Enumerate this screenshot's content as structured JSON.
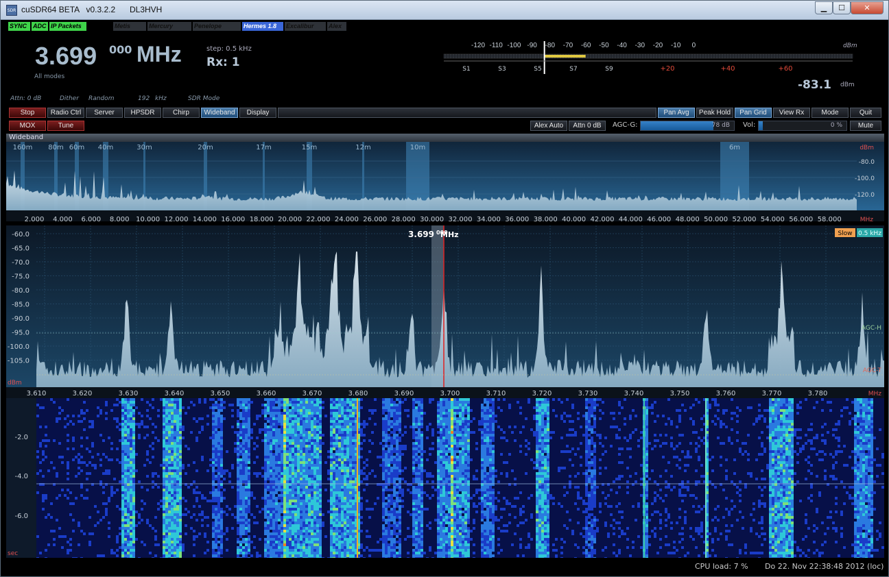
{
  "window": {
    "title": "cuSDR64 BETA   v0.3.2.2",
    "callsign": "DL3HVH",
    "min_label": "▁",
    "max_label": "☐",
    "close_label": "✕"
  },
  "status_indicators": [
    {
      "label": "SYNC",
      "active": true
    },
    {
      "label": "ADC",
      "active": true
    },
    {
      "label": "IP Packets",
      "active": true
    },
    {
      "label": "Metis",
      "active": false
    },
    {
      "label": "Mercury",
      "active": false
    },
    {
      "label": "Penelope",
      "active": false
    },
    {
      "label": "Hermes 1.8",
      "active": true
    },
    {
      "label": "Excalibur",
      "active": false
    },
    {
      "label": "Alex",
      "active": false
    }
  ],
  "display": {
    "frequency_main": "3.699",
    "frequency_sub": "000",
    "frequency_unit": "MHz",
    "step": "step: 0.5 kHz",
    "rx": "Rx: 1",
    "mode": "All modes",
    "attn": "Attn: 0 dB",
    "dither": "Dither",
    "random": "Random",
    "samplerate": "192",
    "samplerate_unit": "kHz",
    "sdr_mode": "SDR Mode",
    "dbm_value": "-83.1",
    "dbm_unit": "dBm"
  },
  "smeter": {
    "dbm_scale": [
      "-120",
      "-110",
      "-100",
      "-90",
      "-80",
      "-70",
      "-60",
      "-50",
      "-40",
      "-30",
      "-20",
      "-10",
      "0"
    ],
    "dbm_label": "dBm",
    "s_scale": [
      "S1",
      "S3",
      "S5",
      "S7",
      "S9"
    ],
    "plus_scale": [
      "+20",
      "+40",
      "+60"
    ],
    "level_dbm": -83.1
  },
  "controls_row1": {
    "stop": "Stop",
    "radio_ctrl": "Radio Ctrl",
    "server": "Server",
    "hpsdr": "HPSDR",
    "chirp": "Chirp",
    "wideband": "Wideband",
    "display": "Display",
    "pan_avg": "Pan Avg",
    "peak_hold": "Peak Hold",
    "pan_grid": "Pan Grid",
    "view_rx": "View Rx",
    "mode": "Mode",
    "quit": "Quit"
  },
  "controls_row2": {
    "mox": "MOX",
    "tune": "Tune",
    "alex_auto": "Alex Auto",
    "attn": "Attn 0 dB",
    "agc_label": "AGC-G:",
    "agc_value": "78 dB",
    "agc_level": 0.78,
    "vol_label": "Vol:",
    "vol_value": "0 %",
    "vol_level": 0.0,
    "mute": "Mute"
  },
  "wideband": {
    "header": "Wideband",
    "dbm_label": "dBm",
    "y_ticks": [
      "-80.0",
      "-100.0",
      "-120.0"
    ],
    "bands": [
      "160m",
      "80m",
      "60m",
      "40m",
      "30m",
      "20m",
      "17m",
      "15m",
      "12m",
      "10m",
      "6m"
    ],
    "x_ticks": [
      "2.000",
      "4.000",
      "6.000",
      "8.000",
      "10.000",
      "12.000",
      "14.000",
      "16.000",
      "18.000",
      "20.000",
      "22.000",
      "24.000",
      "26.000",
      "28.000",
      "30.000",
      "32.000",
      "34.000",
      "36.000",
      "38.000",
      "40.000",
      "42.000",
      "44.000",
      "46.000",
      "48.000",
      "50.000",
      "52.000",
      "54.000",
      "56.000",
      "58.000"
    ],
    "x_unit": "MHz"
  },
  "panadapter": {
    "freq_main": "3.699",
    "freq_sub": "000",
    "freq_unit": "MHz",
    "slow": "Slow",
    "rbw": "0.5 kHz",
    "y_ticks": [
      "-60.0",
      "-65.0",
      "-70.0",
      "-75.0",
      "-80.0",
      "-85.0",
      "-90.0",
      "-95.0",
      "-100.0",
      "-105.0"
    ],
    "dbm_label": "dBm",
    "agc_h": "AGC-H",
    "agc_t": "AGC-T",
    "x_ticks": [
      "3.610",
      "3.620",
      "3.630",
      "3.640",
      "3.650",
      "3.660",
      "3.670",
      "3.680",
      "3.690",
      "3.700",
      "3.710",
      "3.720",
      "3.730",
      "3.740",
      "3.750",
      "3.760",
      "3.770",
      "3.780"
    ],
    "x_unit": "MHz"
  },
  "waterfall": {
    "y_ticks": [
      "-2.0",
      "-4.0",
      "-6.0"
    ],
    "unit": "sec"
  },
  "bottom": {
    "cpu": "CPU load: 7 %",
    "datetime": "Do 22. Nov 22:38:48 2012 (loc)"
  },
  "colors": {
    "accent_blue": "#4a7caa",
    "stop_red": "#7a1e1e",
    "indicator_green": "#3fd44a",
    "indicator_blue": "#3a66d8",
    "tuned_line": "#e02020"
  }
}
